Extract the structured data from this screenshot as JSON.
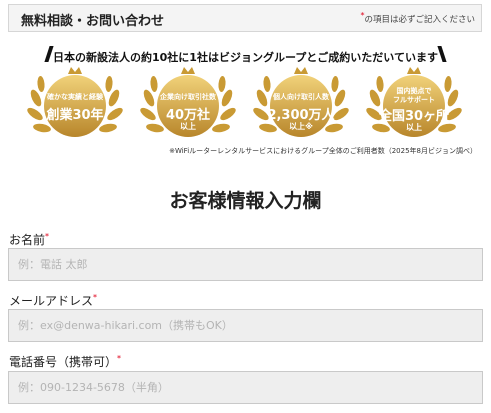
{
  "header": {
    "title": "無料相談・お問い合わせ",
    "required_mark": "*",
    "required_note": "の項目は必ずご記入ください"
  },
  "slogan": "日本の新設法人の約10社に1社はビジョングループとご成約いただいています",
  "badges": [
    {
      "small": "確かな実績と経験",
      "big": "創業30年",
      "sub": ""
    },
    {
      "small": "企業向け取引社数",
      "big": "40万社",
      "sub": "以上"
    },
    {
      "small": "個人向け取引人数",
      "big": "2,300万人",
      "sub": "以上※"
    },
    {
      "small_1": "国内拠点で",
      "small_2": "フルサポート",
      "big": "全国30ヶ所",
      "sub": "以上"
    }
  ],
  "footnote": "※WiFiルーターレンタルサービスにおけるグループ全体のご利用者数（2025年8月ビジョン調べ）",
  "form": {
    "title": "お客様情報入力欄",
    "name": {
      "label": "お名前",
      "placeholder": "例：電話 太郎"
    },
    "email": {
      "label": "メールアドレス",
      "placeholder": "例：ex@denwa-hikari.com（携帯もOK）"
    },
    "phone": {
      "label": "電話番号（携帯可）",
      "placeholder": "例：090-1234-5678（半角）"
    },
    "required_mark": "*"
  },
  "colors": {
    "gold_light": "#e9c46a",
    "gold_dark": "#b8862b",
    "required": "#e0001a",
    "field_bg": "#eeeeee"
  },
  "icons": [
    "laurel-wreath-icon",
    "crown-icon"
  ]
}
